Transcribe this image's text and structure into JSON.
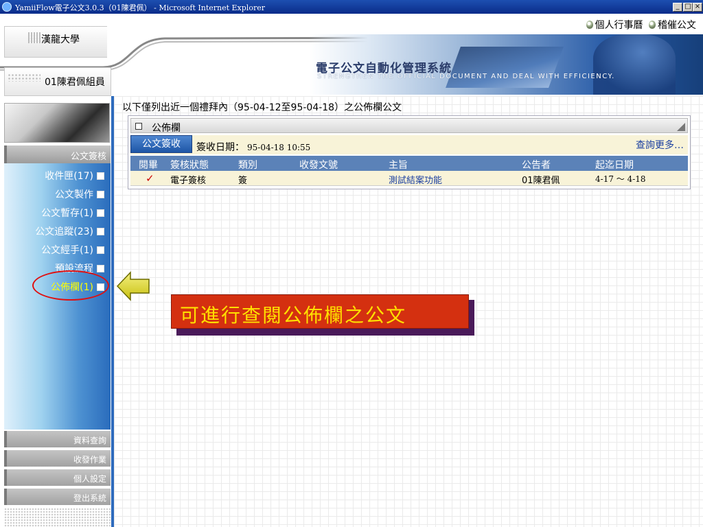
{
  "window": {
    "title": "YamiiFlow電子公文3.0.3（01陳君佩） - Microsoft Internet Explorer",
    "minimize": "_",
    "maximize": "□",
    "close": "×"
  },
  "header": {
    "school": "漢龍大學",
    "links": [
      "個人行事曆",
      "稽催公文"
    ],
    "user": "01陳君佩組員",
    "system_title": "電子公文自動化管理系統",
    "system_subtitle": "STRENGTHEN THE OFFICIAL DOCUMENT AND DEAL WITH EFFICIENCY."
  },
  "sidebar": {
    "section_title": "公文簽核",
    "items": [
      {
        "label": "收件匣(17)"
      },
      {
        "label": "公文製作"
      },
      {
        "label": "公文暫存(1)"
      },
      {
        "label": "公文追蹤(23)"
      },
      {
        "label": "公文經手(1)"
      },
      {
        "label": "預設流程"
      },
      {
        "label": "公佈欄(1)"
      }
    ],
    "bottom_buttons": [
      "資料查詢",
      "收發作業",
      "個人設定",
      "登出系統"
    ]
  },
  "main": {
    "notice": "以下僅列出近一個禮拜內（95-04-12至95-04-18）之公佈欄公文",
    "panel_title": "公佈欄",
    "sign_button": "公文簽收",
    "sign_date_label": "簽收日期：",
    "sign_date_value": "95-04-18 10:55",
    "more_link": "查詢更多…",
    "table": {
      "headers": [
        "閱畢",
        "簽核狀態",
        "類別",
        "收發文號",
        "主旨",
        "公告者",
        "起迄日期"
      ],
      "rows": [
        {
          "read": "✓",
          "status": "電子簽核",
          "type": "簽",
          "doc_no": "",
          "subject": "測試結案功能",
          "announcer": "01陳君佩",
          "dates": "4-17 ～ 4-18"
        }
      ]
    }
  },
  "annotation": {
    "callout": "可進行查閱公佈欄之公文",
    "accent": "#d43010",
    "text_color": "#ffe000"
  }
}
